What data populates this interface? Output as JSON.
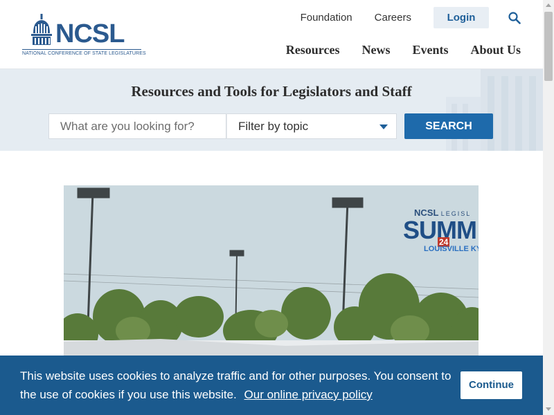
{
  "header": {
    "logo_text": "NCSL",
    "logo_subtitle": "NATIONAL CONFERENCE OF STATE LEGISLATURES",
    "util_nav": [
      "Foundation",
      "Careers"
    ],
    "login_label": "Login",
    "main_nav": [
      "Resources",
      "News",
      "Events",
      "About Us"
    ]
  },
  "hero": {
    "title": "Resources and Tools for Legislators and Staff",
    "search_placeholder": "What are you looking for?",
    "filter_label": "Filter by topic",
    "search_button": "SEARCH"
  },
  "video": {
    "overlay_small": "NCSL",
    "overlay_small_suffix": "LEGISL",
    "overlay_big": "SUMM",
    "overlay_year": "24",
    "overlay_location": "LOUISVILLE KY"
  },
  "cookie_banner": {
    "text": "This website uses cookies to analyze traffic and for other purposes. You consent to the use of cookies if you use this website.",
    "link_text": "Our online privacy policy",
    "button_label": "Continue"
  },
  "colors": {
    "brand_blue": "#1e6aab",
    "cookie_bg": "#1b5a8e",
    "hero_bg": "#e5ecf2"
  }
}
